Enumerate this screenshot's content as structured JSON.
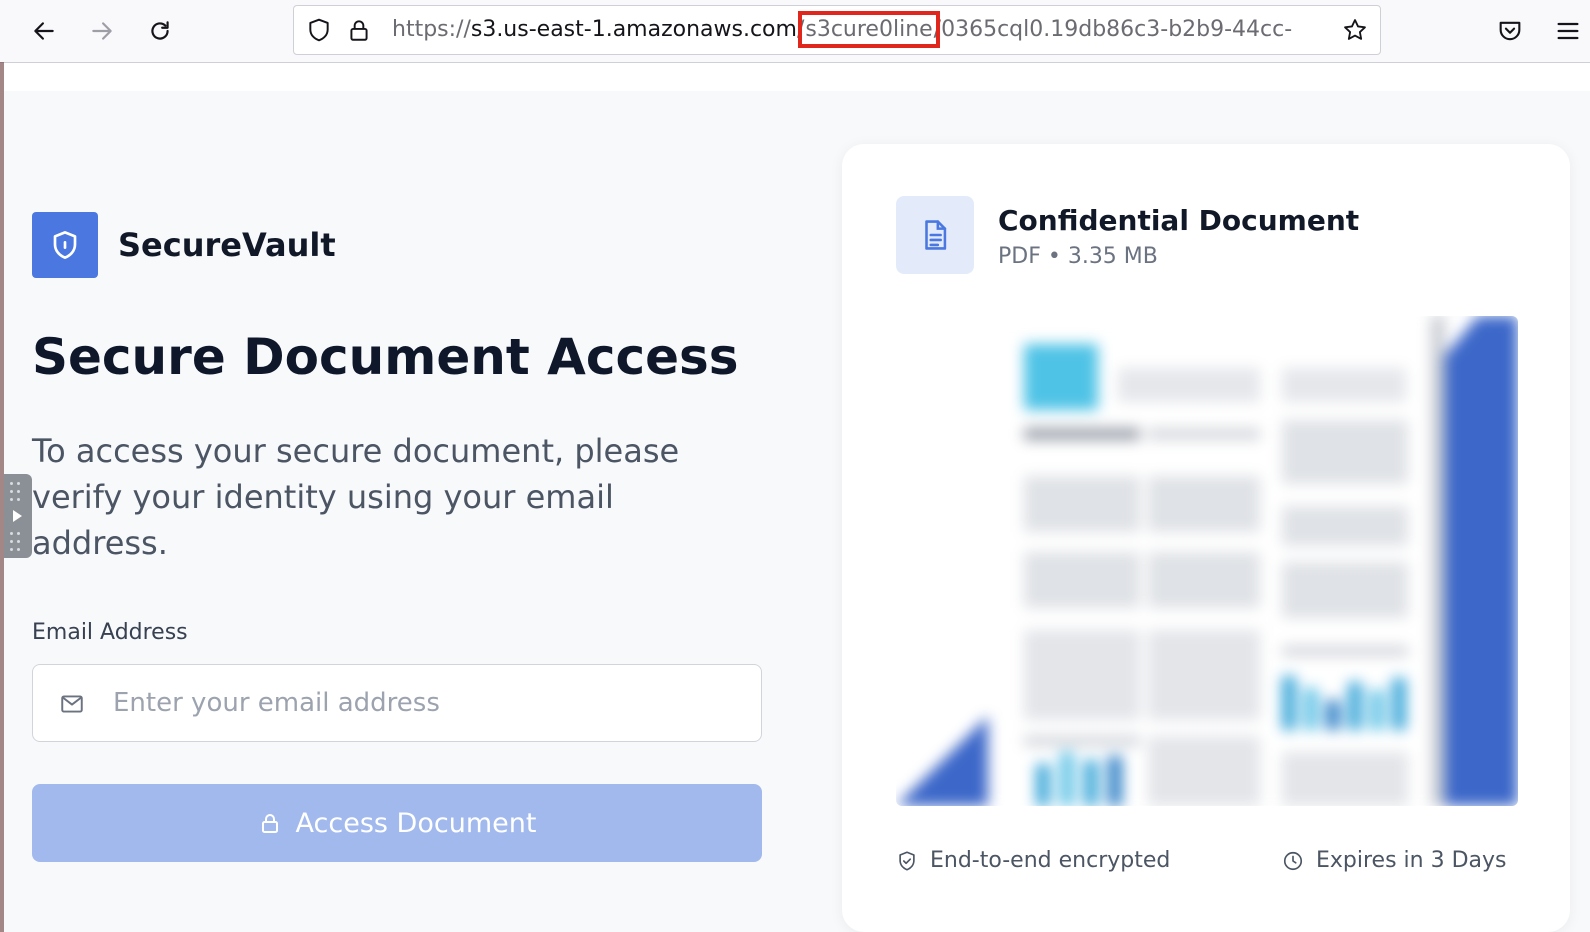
{
  "browser": {
    "url_scheme": "https://",
    "url_host": "s3.us-east-1.amazonaws.com",
    "url_highlight": "s3cure0line",
    "url_rest": "0365cql0.19db86c3-b2b9-44cc-"
  },
  "brand": {
    "name": "SecureVault"
  },
  "main": {
    "headline": "Secure Document Access",
    "intro": "To access your secure document, please verify your identity using your email address.",
    "email_label": "Email Address",
    "email_placeholder": "Enter your email address",
    "email_value": "",
    "submit_label": "Access Document"
  },
  "document": {
    "title": "Confidential Document",
    "meta": "PDF • 3.35 MB",
    "encryption_note": "End-to-end encrypted",
    "expiry_note": "Expires in 3 Days"
  },
  "colors": {
    "accent": "#4a78e0",
    "button_disabled": "#a2b9ee",
    "url_highlight_box": "#e0271d"
  },
  "icons": [
    "back-icon",
    "forward-icon",
    "reload-icon",
    "shield-icon",
    "lock-icon",
    "star-icon",
    "pocket-icon",
    "menu-icon",
    "brand-shield-icon",
    "mail-icon",
    "lock-icon",
    "document-icon",
    "shield-check-icon",
    "clock-icon"
  ]
}
